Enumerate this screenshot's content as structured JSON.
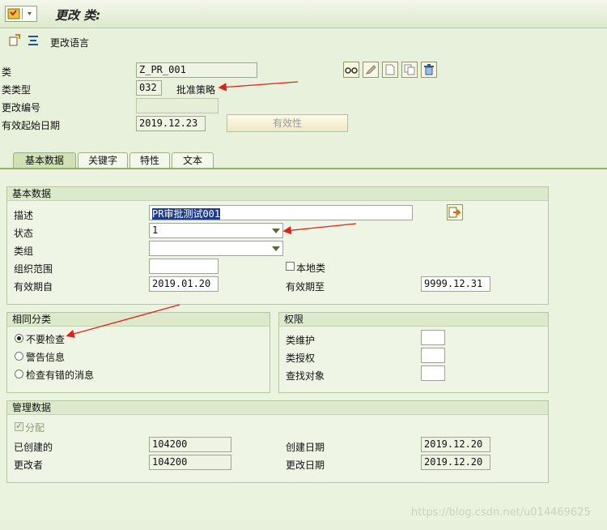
{
  "window": {
    "title": "更改 类:"
  },
  "toolbar": {
    "change_language": "更改语言"
  },
  "header": {
    "class_label": "类",
    "class_value": "Z_PR_001",
    "class_type_label": "类类型",
    "class_type_value": "032",
    "class_type_desc": "批准策略",
    "change_number_label": "更改编号",
    "change_number_value": "",
    "valid_from_label": "有效起始日期",
    "valid_from_value": "2019.12.23",
    "validity_button": "有效性"
  },
  "tabs": [
    {
      "label": "基本数据",
      "active": true
    },
    {
      "label": "关键字",
      "active": false
    },
    {
      "label": "特性",
      "active": false
    },
    {
      "label": "文本",
      "active": false
    }
  ],
  "basic_data": {
    "title": "基本数据",
    "description_label": "描述",
    "description_value": "PR审批测试001",
    "status_label": "状态",
    "status_value": "1",
    "class_group_label": "类组",
    "class_group_value": "",
    "org_area_label": "组织范围",
    "org_area_value": "",
    "local_class_label": "本地类",
    "valid_from_label": "有效期自",
    "valid_from_value": "2019.01.20",
    "valid_to_label": "有效期至",
    "valid_to_value": "9999.12.31"
  },
  "same_classification": {
    "title": "相同分类",
    "options": [
      {
        "label": "不要检查",
        "selected": true
      },
      {
        "label": "警告信息",
        "selected": false
      },
      {
        "label": "检查有错的消息",
        "selected": false
      }
    ]
  },
  "authorization": {
    "title": "权限",
    "maintenance_label": "类维护",
    "maintenance_value": "",
    "class_auth_label": "类授权",
    "class_auth_value": "",
    "find_object_label": "查找对象",
    "find_object_value": ""
  },
  "admin_data": {
    "title": "管理数据",
    "assign_label": "分配",
    "created_by_label": "已创建的",
    "created_by_value": "104200",
    "changed_by_label": "更改者",
    "changed_by_value": "104200",
    "created_on_label": "创建日期",
    "created_on_value": "2019.12.20",
    "changed_on_label": "更改日期",
    "changed_on_value": "2019.12.20"
  },
  "watermark": "https://blog.csdn.net/u014469625",
  "colors": {
    "background": "#e8f1dc",
    "annotation_arrow": "#e0201b",
    "selection": "#1f3c88"
  }
}
